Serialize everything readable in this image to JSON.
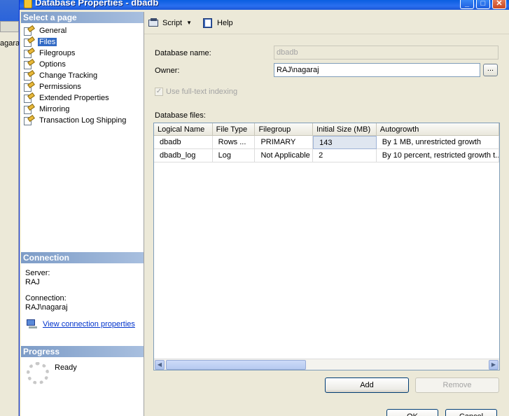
{
  "background_app": {
    "partial_text": "agara"
  },
  "window": {
    "title": "Database Properties - dbadb",
    "controls": {
      "minimize": "_",
      "maximize": "□",
      "close": "✕"
    }
  },
  "left_panel": {
    "select_page_header": "Select a page",
    "pages": [
      {
        "label": "General",
        "icon": "page-wrench-icon"
      },
      {
        "label": "Files",
        "icon": "page-wrench-icon",
        "selected": true
      },
      {
        "label": "Filegroups",
        "icon": "page-wrench-icon"
      },
      {
        "label": "Options",
        "icon": "page-wrench-icon"
      },
      {
        "label": "Change Tracking",
        "icon": "page-wrench-icon"
      },
      {
        "label": "Permissions",
        "icon": "page-wrench-icon"
      },
      {
        "label": "Extended Properties",
        "icon": "page-wrench-icon"
      },
      {
        "label": "Mirroring",
        "icon": "page-wrench-icon"
      },
      {
        "label": "Transaction Log Shipping",
        "icon": "page-wrench-icon"
      }
    ],
    "connection_header": "Connection",
    "server_label": "Server:",
    "server_value": "RAJ",
    "connection_label": "Connection:",
    "connection_value": "RAJ\\nagaraj",
    "view_connection_link": "View connection properties",
    "progress_header": "Progress",
    "progress_status": "Ready"
  },
  "toolbar": {
    "script_label": "Script",
    "help_label": "Help"
  },
  "form": {
    "database_name_label": "Database name:",
    "database_name_value": "dbadb",
    "owner_label": "Owner:",
    "owner_value": "RAJ\\nagaraj",
    "browse_button": "...",
    "fulltext_label": "Use full-text indexing",
    "fulltext_checked": true,
    "database_files_label": "Database files:"
  },
  "grid": {
    "columns": [
      "Logical Name",
      "File Type",
      "Filegroup",
      "Initial Size (MB)",
      "Autogrowth"
    ],
    "rows": [
      [
        "dbadb",
        "Rows ...",
        "PRIMARY",
        "143",
        "By 1 MB, unrestricted growth"
      ],
      [
        "dbadb_log",
        "Log",
        "Not Applicable",
        "2",
        "By 10 percent, restricted growth t..."
      ]
    ]
  },
  "buttons": {
    "add": "Add",
    "remove": "Remove",
    "ok": "OK",
    "cancel": "Cancel"
  },
  "colors": {
    "titlebar": "#0a5ee0",
    "selected_page": "#316ac5",
    "section_header": "#7d9cc7",
    "link": "#0033cc"
  }
}
